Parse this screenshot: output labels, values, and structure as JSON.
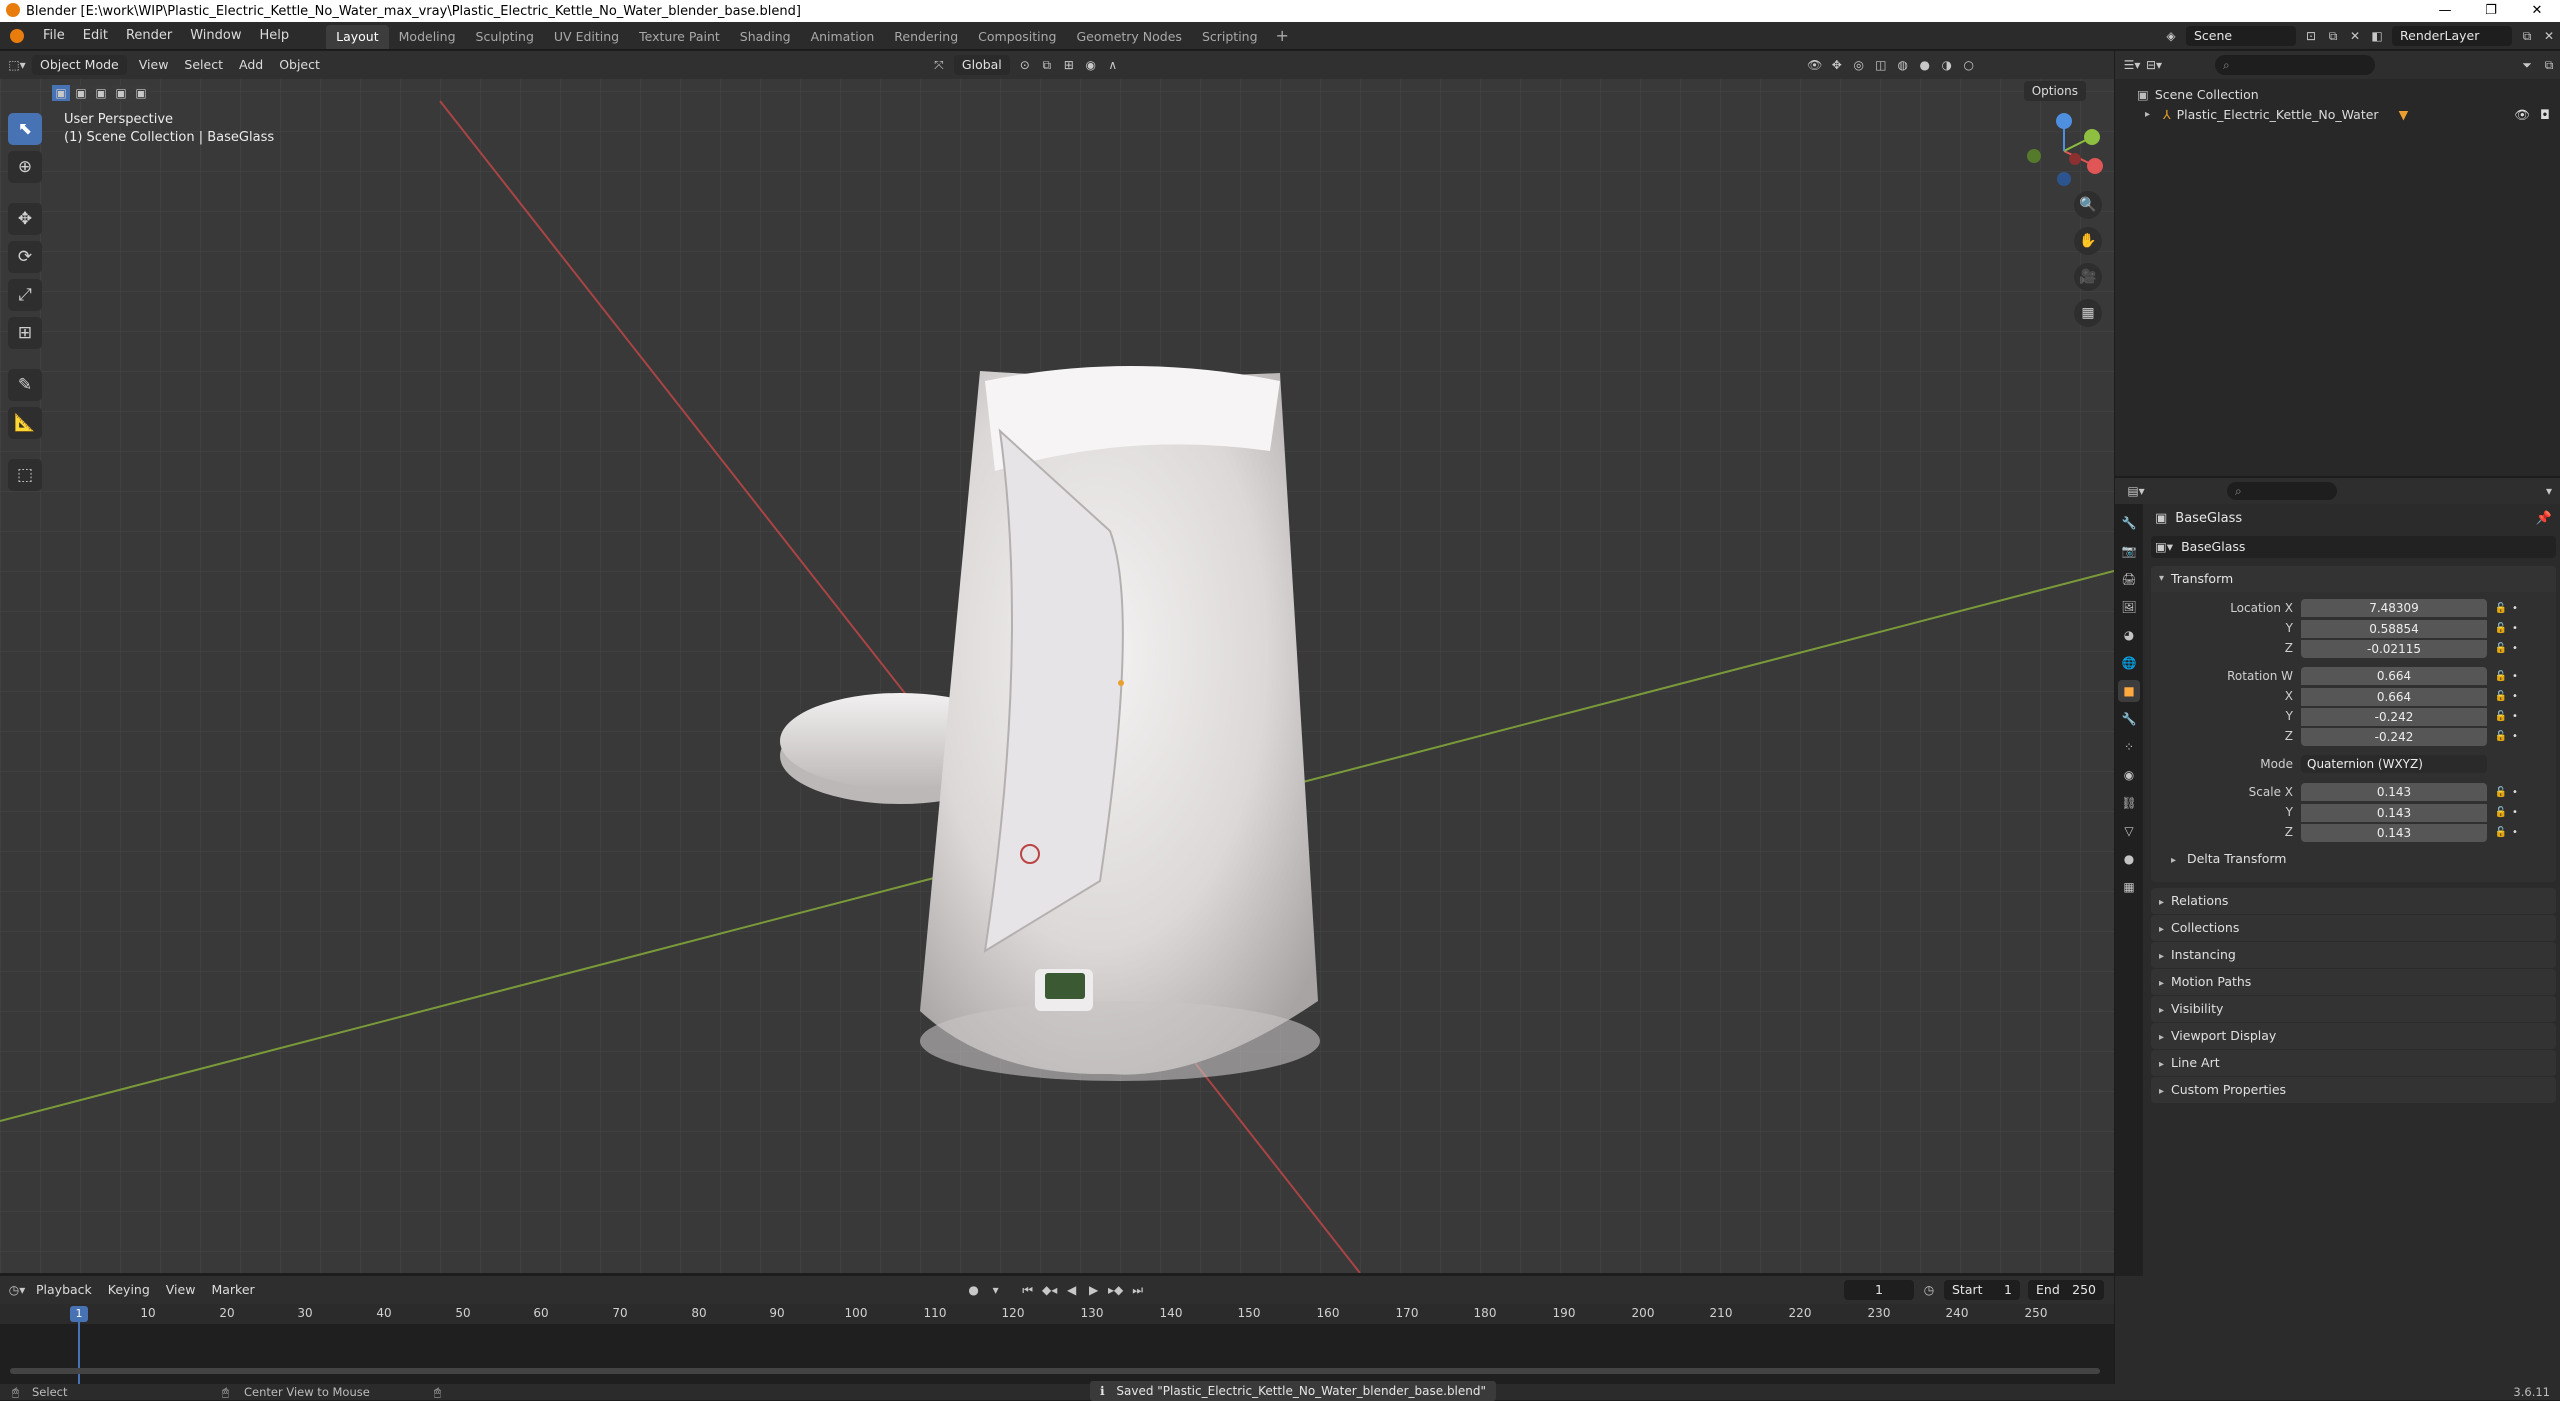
{
  "window": {
    "title": "Blender [E:\\work\\WIP\\Plastic_Electric_Kettle_No_Water_max_vray\\Plastic_Electric_Kettle_No_Water_blender_base.blend]",
    "minimize": "—",
    "restore": "❐",
    "close": "✕"
  },
  "menu": {
    "items": [
      "File",
      "Edit",
      "Render",
      "Window",
      "Help"
    ],
    "workspaces": [
      "Layout",
      "Modeling",
      "Sculpting",
      "UV Editing",
      "Texture Paint",
      "Shading",
      "Animation",
      "Rendering",
      "Compositing",
      "Geometry Nodes",
      "Scripting"
    ],
    "add_tab": "+",
    "scene": "Scene",
    "render_layer": "RenderLayer"
  },
  "viewport": {
    "mode": "Object Mode",
    "header_menus": [
      "View",
      "Select",
      "Add",
      "Object"
    ],
    "transform_orientation": "Global",
    "perspective_label": "User Perspective",
    "collection_label": "(1) Scene Collection | BaseGlass",
    "options": "Options"
  },
  "outliner": {
    "scene_collection": "Scene Collection",
    "object": "Plastic_Electric_Kettle_No_Water"
  },
  "properties": {
    "object_name": "BaseGlass",
    "data_name": "BaseGlass",
    "transform_label": "Transform",
    "location": {
      "label_x": "Location X",
      "x": "7.48309",
      "y": "0.58854",
      "z": "-0.02115"
    },
    "rotation": {
      "label_w": "Rotation W",
      "w": "0.664",
      "x": "0.664",
      "y": "-0.242",
      "z": "-0.242"
    },
    "mode_label": "Mode",
    "mode_value": "Quaternion (WXYZ)",
    "scale": {
      "label_x": "Scale X",
      "x": "0.143",
      "y": "0.143",
      "z": "0.143"
    },
    "axis_labels": {
      "y": "Y",
      "z": "Z",
      "x": "X"
    },
    "delta_transform": "Delta Transform",
    "collapsed_panels": [
      "Relations",
      "Collections",
      "Instancing",
      "Motion Paths",
      "Visibility",
      "Viewport Display",
      "Line Art",
      "Custom Properties"
    ]
  },
  "timeline": {
    "menus": [
      "Playback",
      "Keying",
      "View",
      "Marker"
    ],
    "current_frame": "1",
    "start_label": "Start",
    "start": "1",
    "end_label": "End",
    "end": "250",
    "ticks": [
      "10",
      "20",
      "30",
      "40",
      "50",
      "60",
      "70",
      "80",
      "90",
      "100",
      "110",
      "120",
      "130",
      "140",
      "150",
      "160",
      "170",
      "180",
      "190",
      "200",
      "210",
      "220",
      "230",
      "240",
      "250"
    ],
    "playhead": "1"
  },
  "status": {
    "select": "Select",
    "center_view": "Center View to Mouse",
    "saved": "Saved \"Plastic_Electric_Kettle_No_Water_blender_base.blend\"",
    "version": "3.6.11"
  }
}
